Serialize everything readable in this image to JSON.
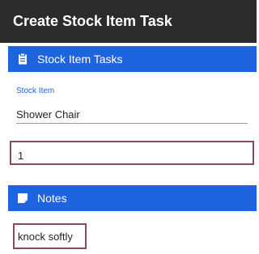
{
  "header": {
    "title": "Create Stock Item Task"
  },
  "sections": {
    "stock_tasks": {
      "label": "Stock Item Tasks",
      "icon": "clipboard-icon"
    },
    "notes": {
      "label": "Notes",
      "icon": "note-icon"
    }
  },
  "stock_item": {
    "label": "Stock Item",
    "value": "Shower Chair"
  },
  "quantity": {
    "value": "1"
  },
  "notes": {
    "value": "knock softly"
  },
  "colors": {
    "accent": "#1e63e0",
    "titlebar": "#2b2b2b",
    "highlight_border": "#8b4a5e"
  }
}
